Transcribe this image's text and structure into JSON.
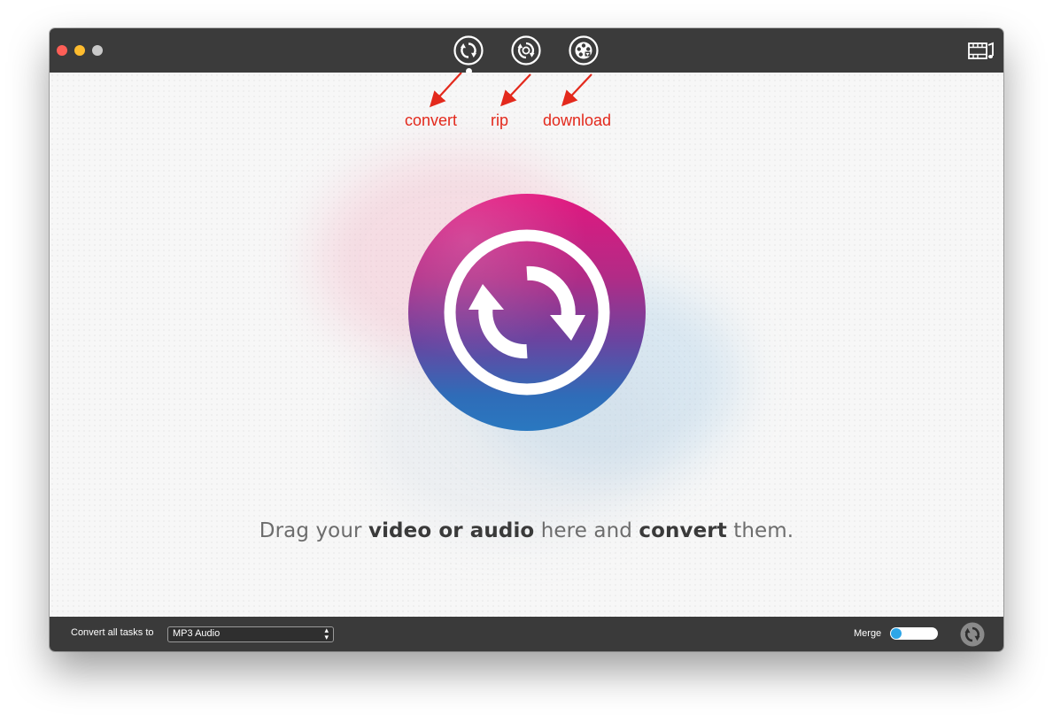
{
  "window": {
    "controls": [
      "close",
      "minimize",
      "zoom"
    ]
  },
  "toolbar": {
    "modes": [
      {
        "id": "convert",
        "icon": "convert-icon",
        "active": true
      },
      {
        "id": "rip",
        "icon": "rip-disc-icon",
        "active": false
      },
      {
        "id": "download",
        "icon": "download-film-icon",
        "active": false
      }
    ],
    "media_icon": "media-library-icon"
  },
  "annotations": {
    "convert": "convert",
    "rip": "rip",
    "download": "download",
    "color": "#e3291c"
  },
  "main": {
    "hero_icon": "convert-icon",
    "drop_text": {
      "part1": "Drag your ",
      "bold1": "video or audio",
      "part2": " here and ",
      "bold2": "convert",
      "part3": " them."
    }
  },
  "bottombar": {
    "convert_label": "Convert all tasks to",
    "format_value": "MP3 Audio",
    "merge_label": "Merge",
    "merge_enabled": false,
    "convert_button_icon": "convert-icon"
  },
  "colors": {
    "titlebar": "#3b3b3b",
    "accent_pink": "#e2177f",
    "accent_blue": "#2a78c0",
    "toggle_knob": "#2ea6e8"
  }
}
